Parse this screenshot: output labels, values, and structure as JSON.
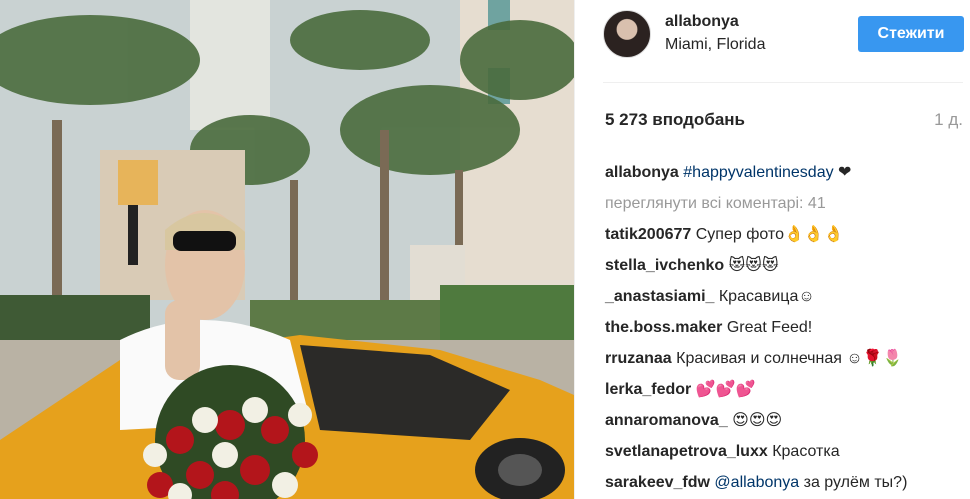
{
  "post": {
    "username": "allabonya",
    "location": "Miami, Florida",
    "follow_label": "Стежити",
    "likes": "5 273 вподобань",
    "time": "1 д.",
    "caption": {
      "user": "allabonya",
      "hashtag": "#happyvalentinesday",
      "text": " ❤"
    },
    "view_all": "переглянути всі коментарі: 41",
    "comments": [
      {
        "user": "tatik200677",
        "text": " Супер фото👌👌👌"
      },
      {
        "user": "stella_ivchenko",
        "text": " 😻😻😻"
      },
      {
        "user": "_anastasiami_",
        "text": " Красавица☺"
      },
      {
        "user": "the.boss.maker",
        "text": " Great Feed!"
      },
      {
        "user": "rruzanaa",
        "text": " Красивая и солнечная ☺🌹🌷"
      },
      {
        "user": "lerka_fedor",
        "text": " 💕💕💕"
      },
      {
        "user": "annaromanova_",
        "text": " 😍😍😍"
      },
      {
        "user": "svetlanapetrova_luxx",
        "text": " Красотка"
      },
      {
        "user": "sarakeev_fdw",
        "mention": "@allabonya",
        "text": " за рулём ты?)"
      }
    ]
  },
  "colors": {
    "accent": "#3897f0",
    "link": "#003569",
    "muted": "#999999"
  }
}
